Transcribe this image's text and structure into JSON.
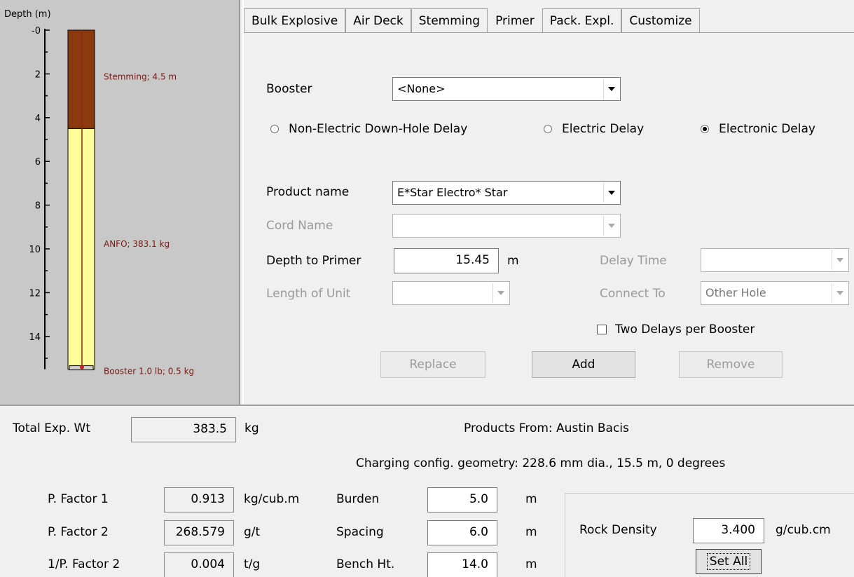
{
  "chart": {
    "axis_title": "Depth (m)",
    "ticks": [
      "-0",
      "2",
      "4",
      "6",
      "8",
      "10",
      "12",
      "14"
    ],
    "layers": [
      {
        "name": "Stemming",
        "label": "Stemming; 4.5 m",
        "from_m": 0,
        "to_m": 4.5,
        "color": "#8b3a0f"
      },
      {
        "name": "ANFO",
        "label": "ANFO; 383.1 kg",
        "from_m": 4.5,
        "to_m": 15.5,
        "color": "#ffff99"
      }
    ],
    "booster_label": "Booster  1.0 lb; 0.5 kg"
  },
  "tabs": [
    {
      "label": "Bulk Explosive"
    },
    {
      "label": "Air Deck"
    },
    {
      "label": "Stemming"
    },
    {
      "label": "Primer",
      "active": true
    },
    {
      "label": "Pack. Expl."
    },
    {
      "label": "Customize"
    }
  ],
  "primer": {
    "booster_label": "Booster",
    "booster_value": "<None>",
    "radio_nonelectric": "Non-Electric Down-Hole Delay",
    "radio_electric": "Electric Delay",
    "radio_electronic": "Electronic Delay",
    "selected_delay": "Electronic Delay",
    "product_label": "Product name",
    "product_value": "E*Star Electro* Star",
    "cord_label": "Cord Name",
    "cord_value": "",
    "depth_label": "Depth to Primer",
    "depth_value": "15.45",
    "depth_unit": "m",
    "delay_time_label": "Delay Time",
    "delay_time_value": "",
    "length_label": "Length of Unit",
    "length_value": "",
    "connect_label": "Connect To",
    "connect_value": "Other Hole",
    "two_delays_label": "Two Delays per Booster",
    "two_delays_checked": false,
    "replace_button": "Replace",
    "add_button": "Add",
    "remove_button": "Remove"
  },
  "bottom": {
    "total_label": "Total Exp. Wt",
    "total_value": "383.5",
    "total_unit": "kg",
    "products_from": "Products From: Austin Bacis",
    "geometry": "Charging config. geometry: 228.6 mm dia., 15.5 m, 0 degrees",
    "pf1_label": "P. Factor 1",
    "pf1_value": "0.913",
    "pf1_unit": "kg/cub.m",
    "pf2_label": "P. Factor 2",
    "pf2_value": "268.579",
    "pf2_unit": "g/t",
    "inv_pf2_label": "1/P. Factor 2",
    "inv_pf2_value": "0.004",
    "inv_pf2_unit": "t/g",
    "burden_label": "Burden",
    "burden_value": "5.0",
    "burden_unit": "m",
    "spacing_label": "Spacing",
    "spacing_value": "6.0",
    "spacing_unit": "m",
    "bench_label": "Bench Ht.",
    "bench_value": "14.0",
    "bench_unit": "m",
    "rock_density_label": "Rock Density",
    "rock_density_value": "3.400",
    "rock_density_unit": "g/cub.cm",
    "set_all_button": "Set All"
  }
}
